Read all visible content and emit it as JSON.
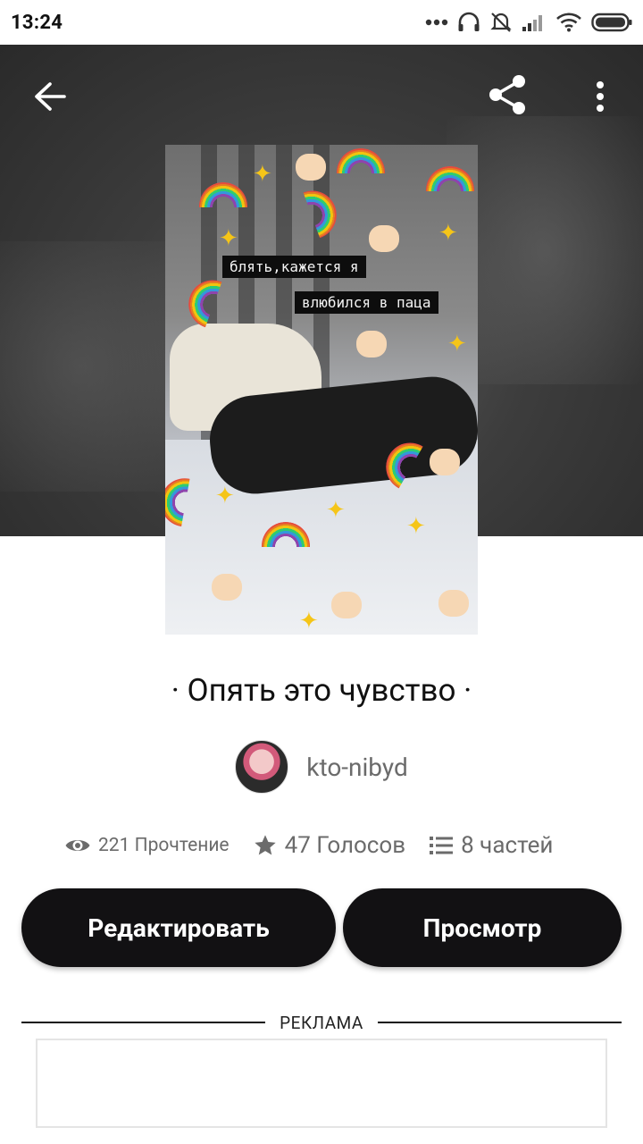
{
  "status_bar": {
    "time": "13:24"
  },
  "story": {
    "title": "· Опять это чувство ·",
    "author": "kto-nibyd",
    "cover_captions": [
      "блять,кажется я",
      "влюбился в паца"
    ]
  },
  "stats": {
    "reads": "221 Прочтение",
    "votes": "47 Голосов",
    "parts": "8 частей"
  },
  "buttons": {
    "edit": "Редактировать",
    "view": "Просмотр"
  },
  "ad": {
    "label": "РЕКЛАМА"
  },
  "icons": [
    "back-arrow-icon",
    "share-icon",
    "more-vert-icon",
    "eye-icon",
    "star-icon",
    "list-icon"
  ],
  "colors": {
    "button_bg": "#121113",
    "header_bg": "#3d3d3d",
    "muted_text": "#6b6b6b"
  }
}
